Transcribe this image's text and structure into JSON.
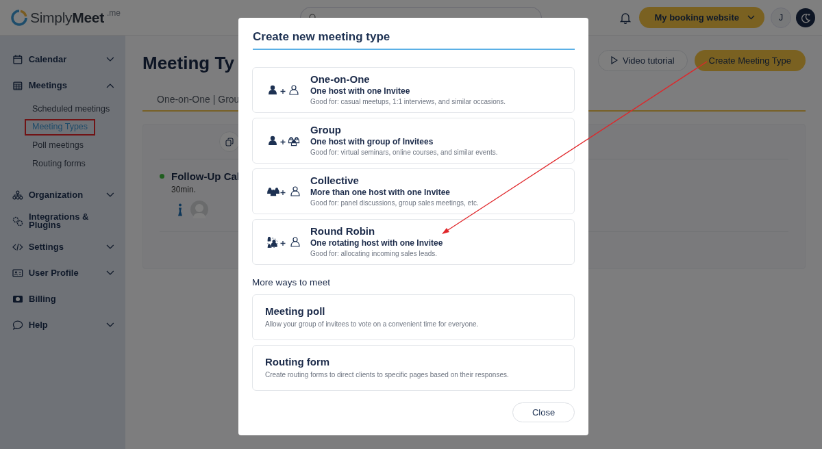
{
  "topbar": {
    "logo": {
      "text": "Simply**Meet**",
      "suffix": ".me"
    },
    "booking_button": "My booking website",
    "avatar": "J"
  },
  "sidebar": {
    "items": [
      {
        "label": "Calendar",
        "kind": "group",
        "expanded": false
      },
      {
        "label": "Meetings",
        "kind": "group",
        "expanded": true,
        "children": [
          {
            "label": "Scheduled meetings",
            "selected": false,
            "highlighted": false
          },
          {
            "label": "Meeting Types",
            "selected": true,
            "highlighted": true
          },
          {
            "label": "Poll meetings",
            "selected": false,
            "highlighted": false
          },
          {
            "label": "Routing forms",
            "selected": false,
            "highlighted": false
          }
        ]
      },
      {
        "label": "Organization",
        "kind": "group",
        "expanded": false
      },
      {
        "label": "Integrations & Plugins",
        "kind": "link"
      },
      {
        "label": "Settings",
        "kind": "group",
        "expanded": false
      },
      {
        "label": "User Profile",
        "kind": "group",
        "expanded": false
      },
      {
        "label": "Billing",
        "kind": "link"
      },
      {
        "label": "Help",
        "kind": "group",
        "expanded": false
      }
    ]
  },
  "page": {
    "title": "Meeting Ty",
    "actions": [
      {
        "label": "Video tutorial",
        "kind": "outline"
      },
      {
        "label": "Create Meeting Type",
        "kind": "primary"
      }
    ],
    "tabs_text": "One-on-One | Grou",
    "event": {
      "title": "Follow-Up Cal",
      "duration": "30min.",
      "active": true
    }
  },
  "dialog": {
    "title": "Create new meeting type",
    "options": [
      {
        "kind": "type",
        "title": "One-on-One",
        "subtitle": "One host with one Invitee",
        "description": "Good for: casual meetups, 1:1 interviews, and similar occasions."
      },
      {
        "kind": "type",
        "title": "Group",
        "subtitle": "One host with group of Invitees",
        "description": "Good for: virtual seminars, online courses, and similar events."
      },
      {
        "kind": "type",
        "title": "Collective",
        "subtitle": "More than one host with one Invitee",
        "description": "Good for: panel discussions, group sales meetings, etc."
      },
      {
        "kind": "type",
        "title": "Round Robin",
        "subtitle": "One rotating host with one Invitee",
        "description": "Good for: allocating incoming sales leads."
      }
    ],
    "section_title": "More ways to meet",
    "more": [
      {
        "kind": "option",
        "title": "Meeting poll",
        "description": "Allow your group of invitees to vote on a convenient time for everyone."
      },
      {
        "kind": "option",
        "title": "Routing form",
        "description": "Create routing forms to direct clients to specific pages based on their responses."
      }
    ],
    "close_button": "Close"
  },
  "annotation_arrow": true
}
